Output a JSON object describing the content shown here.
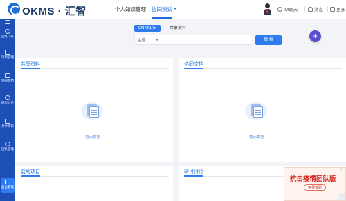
{
  "header": {
    "logo_text": "OKMS · 汇智",
    "nav": [
      {
        "label": "个人知识管理"
      },
      {
        "label": "协同测试"
      }
    ],
    "utilities": {
      "im_label": "IM聊天",
      "message_label": "消息",
      "more_label": "更多"
    }
  },
  "sidebar": {
    "items": [
      {
        "label": "团队工作"
      },
      {
        "label": "项目管理"
      },
      {
        "label": "协同文档"
      },
      {
        "label": "研讨讨论"
      },
      {
        "label": "共享资料"
      },
      {
        "label": "团队管理"
      }
    ],
    "active_label": "后台管理"
  },
  "search": {
    "tabs": [
      {
        "label": "CNKI知识"
      },
      {
        "label": "共享资料"
      }
    ],
    "select_value": "主题",
    "button_label": "检 索"
  },
  "panels": {
    "shared": {
      "title": "共享资料",
      "empty_text": "暂无数据"
    },
    "docs": {
      "title": "协同文档",
      "empty_text": "暂无数据"
    },
    "projects": {
      "title": "我的项目"
    },
    "discussion": {
      "title": "研讨讨论"
    }
  },
  "promo": {
    "title": "抗击疫情团队版",
    "button_label": "免费体验"
  },
  "colors": {
    "brand": "#1e6fd9",
    "sidebar": "#1e4fb5",
    "accent_button": "#2f7cf0",
    "promo_red": "#d6241e"
  },
  "icons": {
    "logo": "okms-logo-icon",
    "plus": "plus-icon",
    "im": "chat-icon",
    "message": "bell-icon",
    "more": "grid-icon"
  }
}
